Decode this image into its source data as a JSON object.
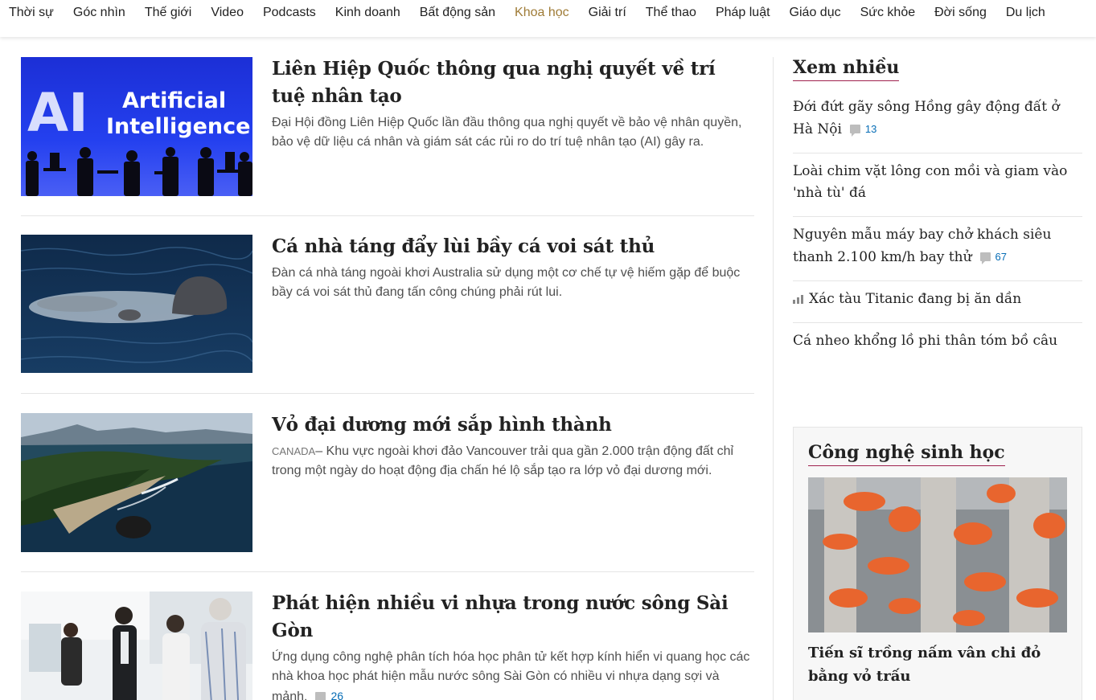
{
  "nav": {
    "items": [
      "Thời sự",
      "Góc nhìn",
      "Thế giới",
      "Video",
      "Podcasts",
      "Kinh doanh",
      "Bất động sản",
      "Khoa học",
      "Giải trí",
      "Thể thao",
      "Pháp luật",
      "Giáo dục",
      "Sức khỏe",
      "Đời sống",
      "Du lịch"
    ],
    "active": "Khoa học",
    "active_color": "#9f7b36"
  },
  "articles": [
    {
      "title": "Liên Hiệp Quốc thông qua nghị quyết về trí tuệ nhân tạo",
      "location": "",
      "description": "Đại Hội đồng Liên Hiệp Quốc lần đầu thông qua nghị quyết về bảo vệ nhân quyền, bảo vệ dữ liệu cá nhân và giám sát các rủi ro do trí tuệ nhân tạo (AI) gây ra.",
      "comments": "",
      "image_text": {
        "big": "AI",
        "line1": "Artificial",
        "line2": "Intelligence"
      }
    },
    {
      "title": "Cá nhà táng đẩy lùi bầy cá voi sát thủ",
      "location": "",
      "description": "Đàn cá nhà táng ngoài khơi Australia sử dụng một cơ chế tự vệ hiếm gặp để buộc bầy cá voi sát thủ đang tấn công chúng phải rút lui.",
      "comments": ""
    },
    {
      "title": "Vỏ đại dương mới sắp hình thành",
      "location": "Canada",
      "description": "Khu vực ngoài khơi đảo Vancouver trải qua gần 2.000 trận động đất chỉ trong một ngày do hoạt động địa chấn hé lộ sắp tạo ra lớp vỏ đại dương mới.",
      "comments": ""
    },
    {
      "title": "Phát hiện nhiều vi nhựa trong nước sông Sài Gòn",
      "location": "",
      "description": "Ứng dụng công nghệ phân tích hóa học phân tử kết hợp kính hiển vi quang học các nhà khoa học phát hiện mẫu nước sông Sài Gòn có nhiều vi nhựa dạng sợi và mảnh.",
      "comments": "26"
    }
  ],
  "sidebar": {
    "title": "Xem nhiều",
    "items": [
      {
        "text": "Đới đứt gãy sông Hồng gây động đất ở Hà Nội",
        "comments": "13",
        "trending": false
      },
      {
        "text": "Loài chim vặt lông con mồi và giam vào 'nhà tù' đá",
        "comments": "",
        "trending": false
      },
      {
        "text": "Nguyên mẫu máy bay chở khách siêu thanh 2.100 km/h bay thử",
        "comments": "67",
        "trending": false
      },
      {
        "text": "Xác tàu Titanic đang bị ăn dần",
        "comments": "",
        "trending": true
      },
      {
        "text": "Cá nheo khổng lồ phi thân tóm bồ câu",
        "comments": "",
        "trending": false
      }
    ]
  },
  "box": {
    "title": "Công nghệ sinh học",
    "article_title": "Tiến sĩ trồng nấm vân chi đỏ bằng vỏ trấu"
  },
  "colors": {
    "accent": "#9f224e",
    "comment": "#076db6"
  }
}
